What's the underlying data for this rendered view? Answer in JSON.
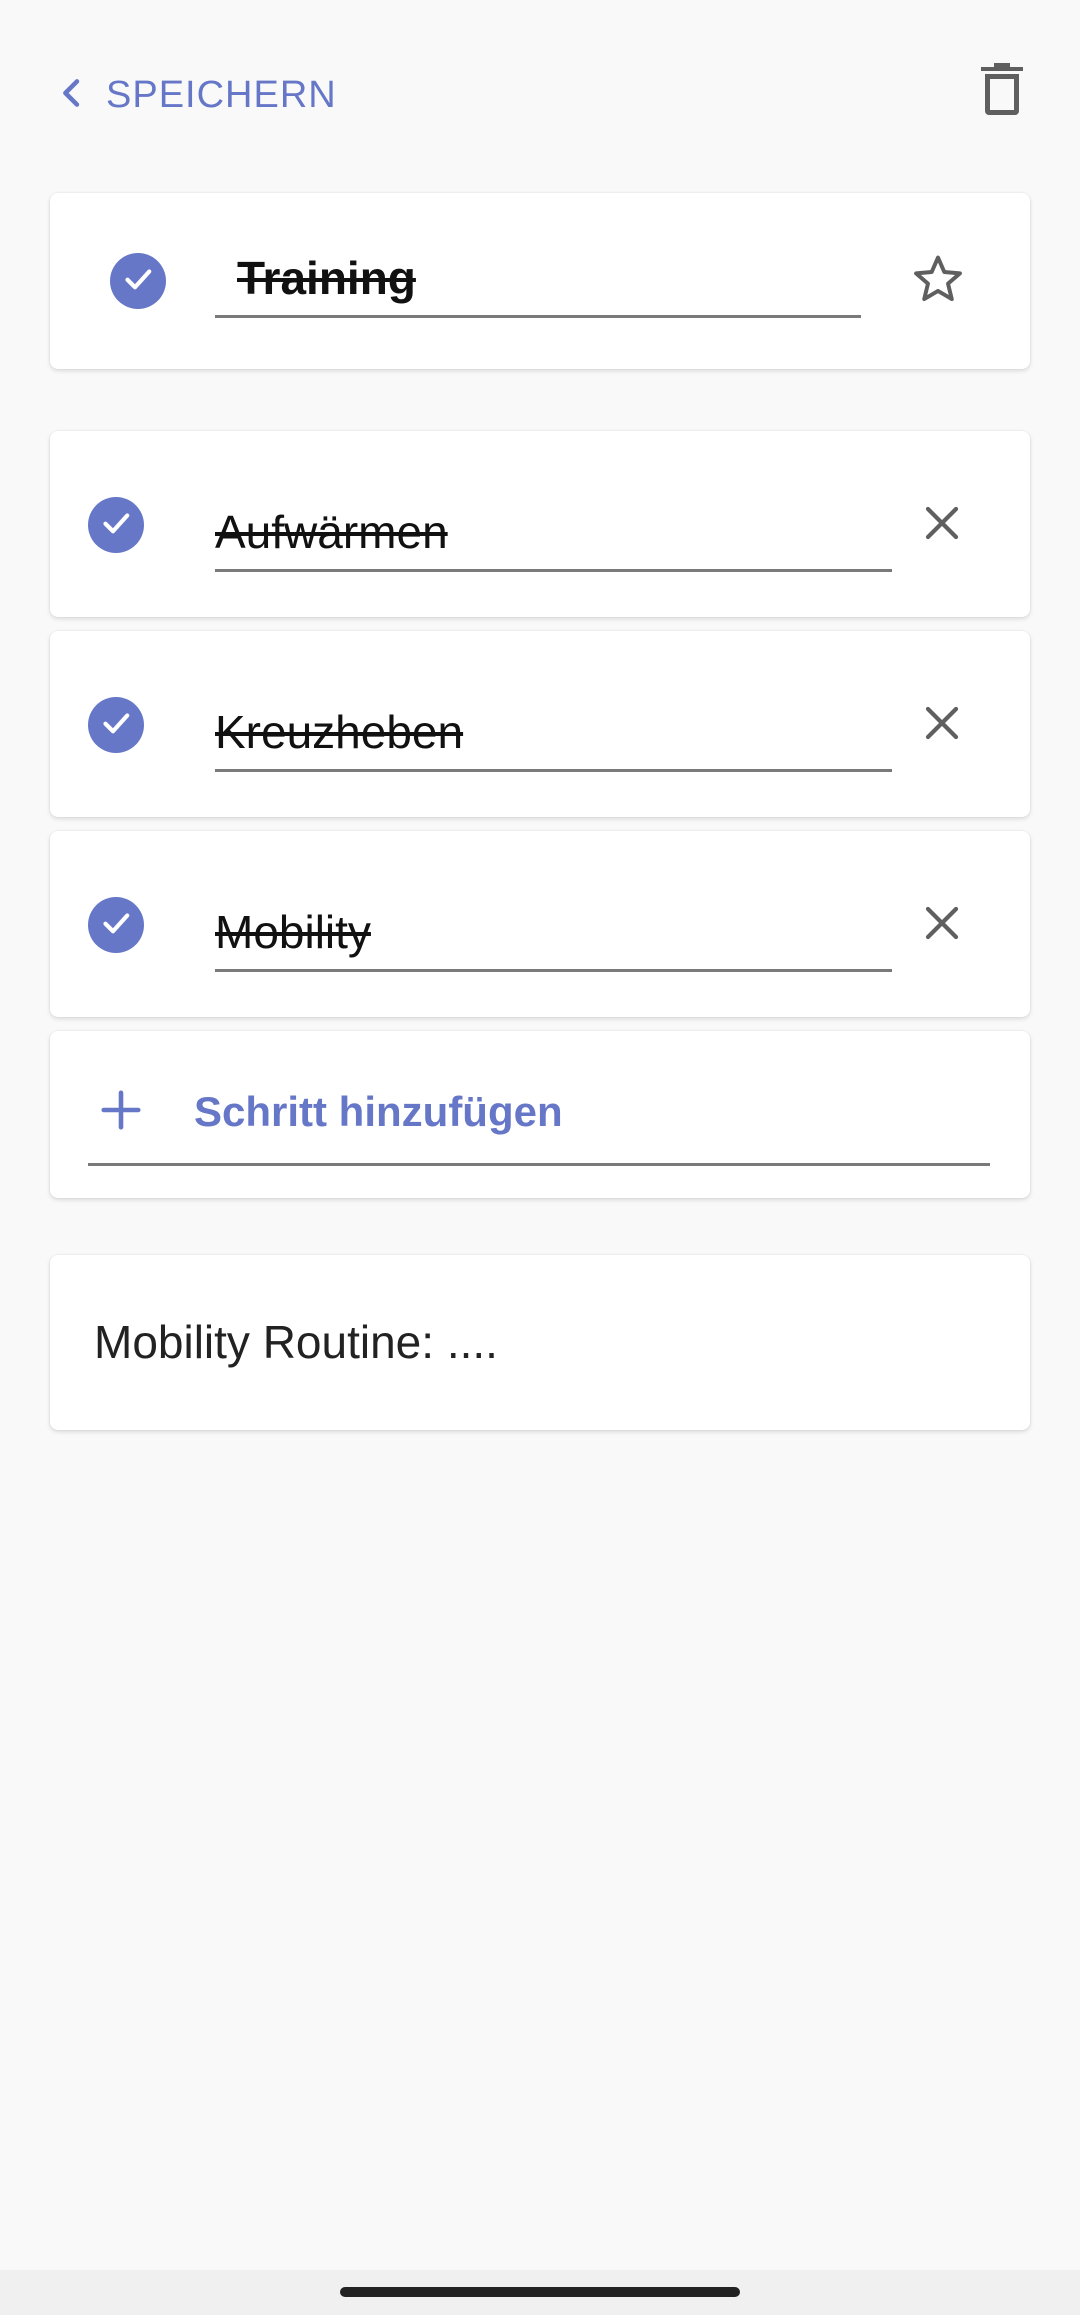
{
  "header": {
    "back_label": "SPEICHERN",
    "back_icon": "chevron-left-icon",
    "delete_icon": "trash-icon"
  },
  "task": {
    "title": "Training",
    "completed": true,
    "starred": false
  },
  "steps": [
    {
      "label": "Aufwärmen",
      "completed": true
    },
    {
      "label": "Kreuzheben",
      "completed": true
    },
    {
      "label": "Mobility",
      "completed": true
    }
  ],
  "add_step": {
    "label": "Schritt hinzufügen"
  },
  "note": {
    "text": "Mobility Routine: ...."
  },
  "colors": {
    "accent": "#6677c8",
    "background": "#f9f9f9",
    "card": "#ffffff",
    "icon_gray": "#5f5f5f"
  }
}
